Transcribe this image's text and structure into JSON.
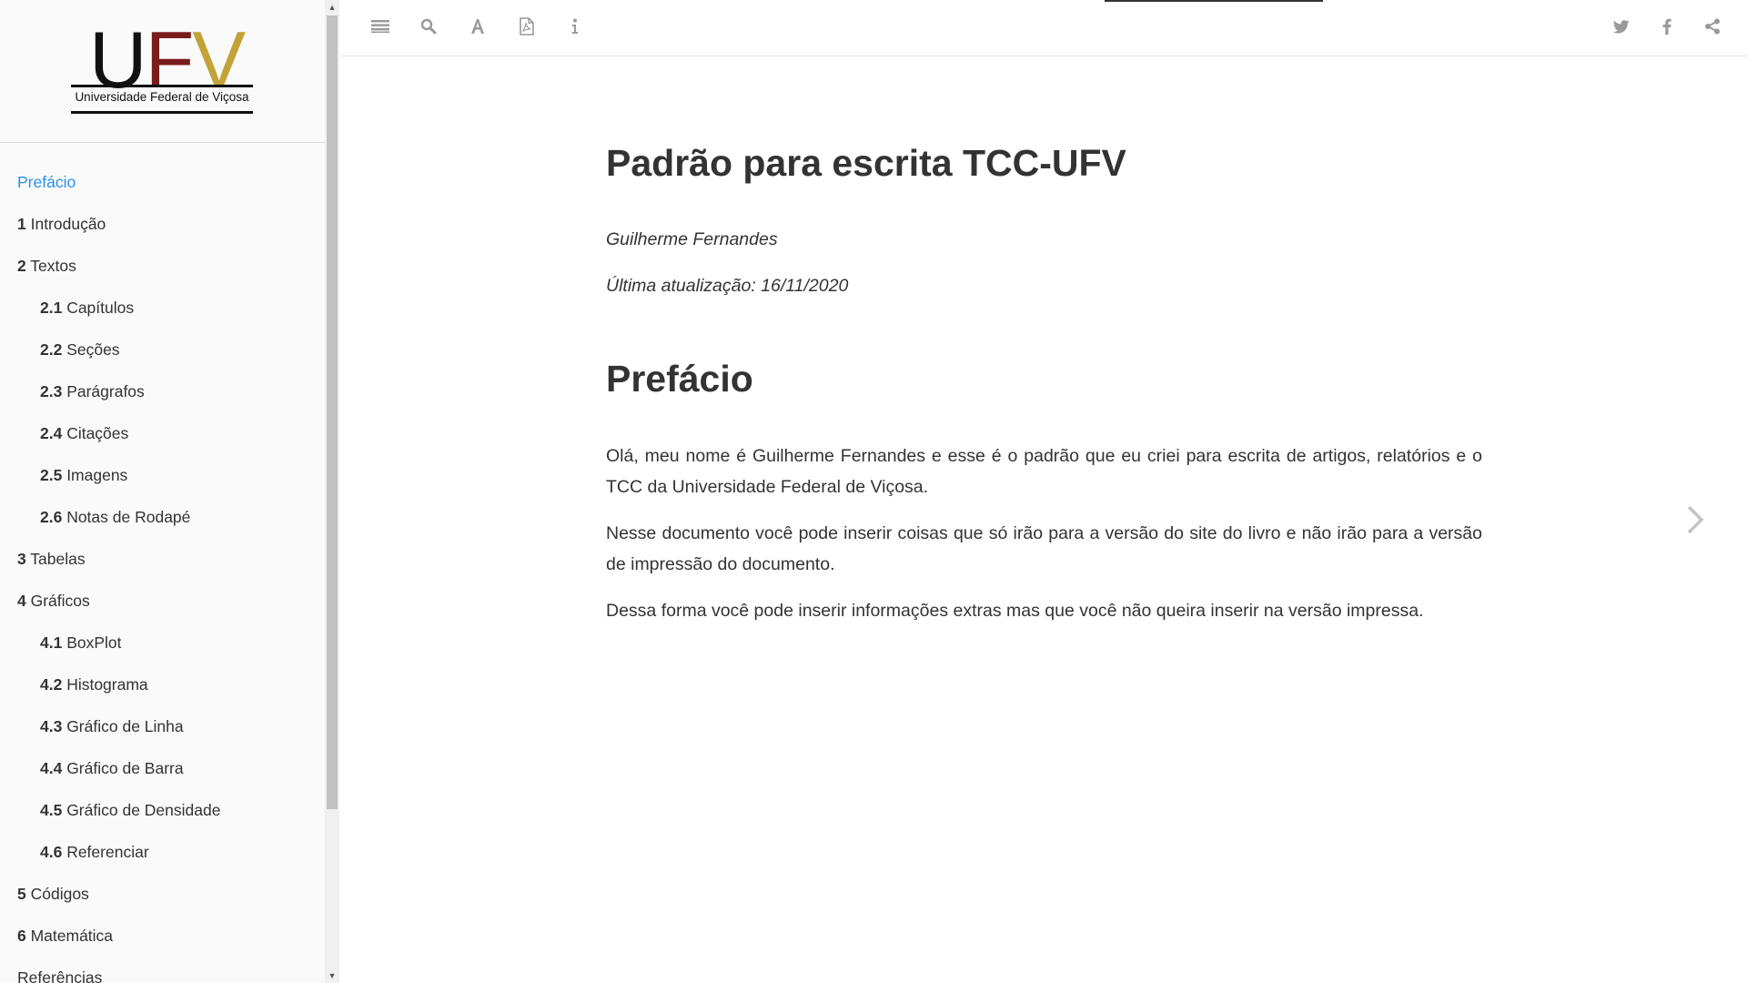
{
  "logo": {
    "letter_u": "U",
    "letter_f": "F",
    "letter_v": "V",
    "caption": "Universidade Federal de Viçosa",
    "colors": {
      "u": "#111111",
      "f": "#7a1c1c",
      "v": "#c2a338"
    }
  },
  "toc": [
    {
      "num": "",
      "label": "Prefácio",
      "level": 1,
      "active": true
    },
    {
      "num": "1",
      "label": " Introdução",
      "level": 1
    },
    {
      "num": "2",
      "label": " Textos",
      "level": 1
    },
    {
      "num": "2.1",
      "label": " Capítulos",
      "level": 2
    },
    {
      "num": "2.2",
      "label": " Seções",
      "level": 2
    },
    {
      "num": "2.3",
      "label": " Parágrafos",
      "level": 2
    },
    {
      "num": "2.4",
      "label": " Citações",
      "level": 2
    },
    {
      "num": "2.5",
      "label": " Imagens",
      "level": 2
    },
    {
      "num": "2.6",
      "label": " Notas de Rodapé",
      "level": 2
    },
    {
      "num": "3",
      "label": " Tabelas",
      "level": 1
    },
    {
      "num": "4",
      "label": " Gráficos",
      "level": 1
    },
    {
      "num": "4.1",
      "label": " BoxPlot",
      "level": 2
    },
    {
      "num": "4.2",
      "label": " Histograma",
      "level": 2
    },
    {
      "num": "4.3",
      "label": " Gráfico de Linha",
      "level": 2
    },
    {
      "num": "4.4",
      "label": " Gráfico de Barra",
      "level": 2
    },
    {
      "num": "4.5",
      "label": " Gráfico de Densidade",
      "level": 2
    },
    {
      "num": "4.6",
      "label": " Referenciar",
      "level": 2
    },
    {
      "num": "5",
      "label": " Códigos",
      "level": 1
    },
    {
      "num": "6",
      "label": " Matemática",
      "level": 1
    },
    {
      "num": "",
      "label": "Referências",
      "level": 1
    }
  ],
  "toolbar": {
    "left_icons": [
      "menu-icon",
      "search-icon",
      "font-settings-icon",
      "pdf-icon",
      "info-icon"
    ],
    "right_icons": [
      "twitter-icon",
      "facebook-icon",
      "share-icon"
    ],
    "icon_color": "#999999"
  },
  "main": {
    "title": "Padrão para escrita TCC-UFV",
    "author": "Guilherme Fernandes",
    "updated": "Última atualização: 16/11/2020",
    "section_title": "Prefácio",
    "paragraphs": [
      "Olá, meu nome é Guilherme Fernandes e esse é o padrão que eu criei para escrita de artigos, relatórios e o TCC da Universidade Federal de Viçosa.",
      "Nesse documento você pode inserir coisas que só irão para a versão do site do livro e não irão para a versão de impressão do documento.",
      "Dessa forma você pode inserir informações extras mas que você não queira inserir na versão impressa."
    ]
  },
  "navigation": {
    "next_icon": "chevron-right-icon"
  },
  "accent_color": "#2a8ff0"
}
